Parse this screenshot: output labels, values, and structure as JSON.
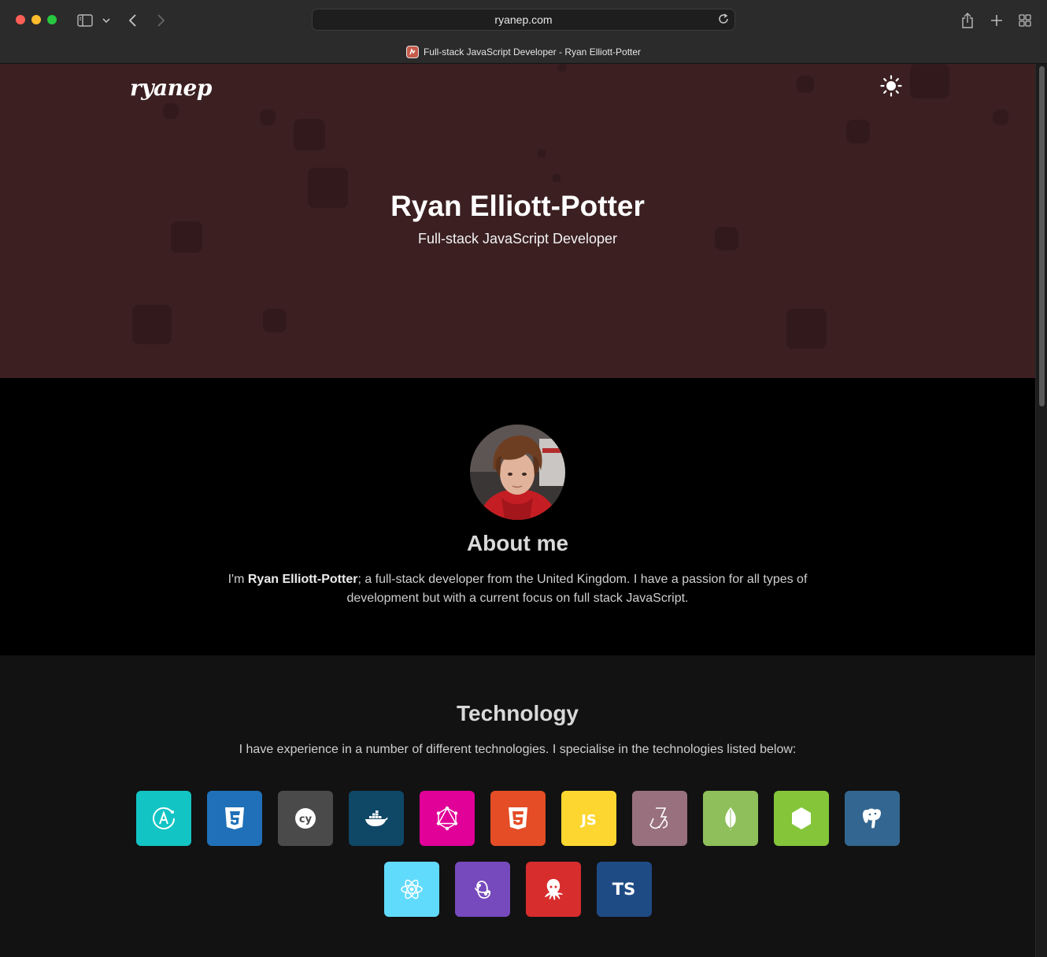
{
  "browser": {
    "url": "ryanep.com",
    "tab_title": "Full-stack JavaScript Developer - Ryan Elliott-Potter"
  },
  "header": {
    "logo_text": "ryanep",
    "theme_toggle_icon": "sun-icon"
  },
  "hero": {
    "title": "Ryan Elliott-Potter",
    "subtitle": "Full-stack JavaScript Developer",
    "background_color": "#3b1f21"
  },
  "about": {
    "title": "About me",
    "text_prefix": "I'm ",
    "name": "Ryan Elliott-Potter",
    "text_suffix": "; a full-stack developer from the United Kingdom. I have a passion for all types of development but with a current focus on full stack JavaScript."
  },
  "technology": {
    "title": "Technology",
    "description": "I have experience in a number of different technologies. I specialise in the technologies listed below:",
    "tiles": [
      {
        "icon": "apollo-icon",
        "color": "#13c4c4"
      },
      {
        "icon": "css3-icon",
        "color": "#1f70b8"
      },
      {
        "icon": "cypress-icon",
        "color": "#4a4a4a"
      },
      {
        "icon": "docker-icon",
        "color": "#0f4766"
      },
      {
        "icon": "graphql-icon",
        "color": "#e10098"
      },
      {
        "icon": "html5-icon",
        "color": "#e44d26"
      },
      {
        "icon": "javascript-icon",
        "color": "#fdd730"
      },
      {
        "icon": "jest-icon",
        "color": "#99707e"
      },
      {
        "icon": "mongodb-icon",
        "color": "#8ebf5a"
      },
      {
        "icon": "nodejs-icon",
        "color": "#84c53a"
      },
      {
        "icon": "postgresql-icon",
        "color": "#336690"
      },
      {
        "icon": "react-icon",
        "color": "#61dbfb"
      },
      {
        "icon": "redux-icon",
        "color": "#764abc"
      },
      {
        "icon": "octopus-icon",
        "color": "#d82d2d"
      },
      {
        "icon": "typescript-icon",
        "color": "#1f4b85",
        "label": "TS"
      }
    ]
  }
}
